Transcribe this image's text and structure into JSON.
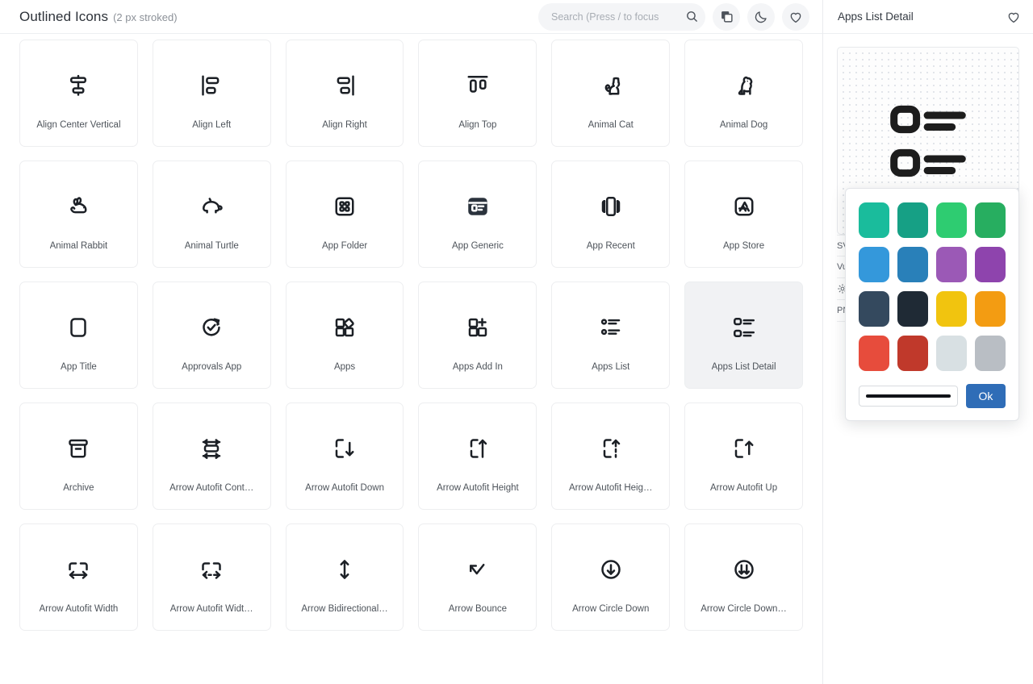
{
  "header": {
    "title_main": "Outlined Icons",
    "title_sub": "(2 px stroked)",
    "search": {
      "placeholder": "Search (Press / to focus",
      "value": ""
    },
    "buttons": [
      {
        "name": "copy-button",
        "icon": "copy-icon"
      },
      {
        "name": "dark-mode-button",
        "icon": "moon-icon"
      },
      {
        "name": "favorites-button",
        "icon": "heart-icon"
      }
    ]
  },
  "grid": {
    "icons": [
      {
        "label": "Align Center Vertical",
        "icon": "align-center-vertical-icon"
      },
      {
        "label": "Align Left",
        "icon": "align-left-icon"
      },
      {
        "label": "Align Right",
        "icon": "align-right-icon"
      },
      {
        "label": "Align Top",
        "icon": "align-top-icon"
      },
      {
        "label": "Animal Cat",
        "icon": "animal-cat-icon"
      },
      {
        "label": "Animal Dog",
        "icon": "animal-dog-icon"
      },
      {
        "label": "Animal Rabbit",
        "icon": "animal-rabbit-icon"
      },
      {
        "label": "Animal Turtle",
        "icon": "animal-turtle-icon"
      },
      {
        "label": "App Folder",
        "icon": "app-folder-icon"
      },
      {
        "label": "App Generic",
        "icon": "app-generic-icon"
      },
      {
        "label": "App Recent",
        "icon": "app-recent-icon"
      },
      {
        "label": "App Store",
        "icon": "app-store-icon"
      },
      {
        "label": "App Title",
        "icon": "app-title-icon"
      },
      {
        "label": "Approvals App",
        "icon": "approvals-app-icon"
      },
      {
        "label": "Apps",
        "icon": "apps-icon"
      },
      {
        "label": "Apps Add In",
        "icon": "apps-add-in-icon"
      },
      {
        "label": "Apps List",
        "icon": "apps-list-icon"
      },
      {
        "label": "Apps List Detail",
        "icon": "apps-list-detail-icon",
        "selected": true
      },
      {
        "label": "Archive",
        "icon": "archive-icon"
      },
      {
        "label": "Arrow Autofit Cont…",
        "icon": "arrow-autofit-content-icon"
      },
      {
        "label": "Arrow Autofit Down",
        "icon": "arrow-autofit-down-icon"
      },
      {
        "label": "Arrow Autofit Height",
        "icon": "arrow-autofit-height-icon"
      },
      {
        "label": "Arrow Autofit Heig…",
        "icon": "arrow-autofit-height-dotted-icon"
      },
      {
        "label": "Arrow Autofit Up",
        "icon": "arrow-autofit-up-icon"
      },
      {
        "label": "Arrow Autofit Width",
        "icon": "arrow-autofit-width-icon"
      },
      {
        "label": "Arrow Autofit Widt…",
        "icon": "arrow-autofit-width-dotted-icon"
      },
      {
        "label": "Arrow Bidirectional…",
        "icon": "arrow-bidirectional-up-down-icon"
      },
      {
        "label": "Arrow Bounce",
        "icon": "arrow-bounce-icon"
      },
      {
        "label": "Arrow Circle Down",
        "icon": "arrow-circle-down-icon"
      },
      {
        "label": "Arrow Circle Down…",
        "icon": "arrow-circle-down-double-icon"
      }
    ]
  },
  "detail": {
    "title": "Apps List Detail",
    "favorite_icon": "heart-icon",
    "preview_icon": "apps-list-detail-icon",
    "color_dot": "#1d1d1d",
    "rows": [
      {
        "label": "SVG",
        "action_icon": "copy-icon"
      },
      {
        "label": "Vue",
        "action_icon": "download-icon"
      },
      {
        "label": "",
        "leading_icon": "gear-icon",
        "action_icon": "chevron-right-icon"
      },
      {
        "label": "PNG",
        "action_icon": "download-icon"
      }
    ]
  },
  "color_popup": {
    "swatches": [
      "#1abc9c",
      "#16a085",
      "#2ecc71",
      "#27ae60",
      "#3498db",
      "#2980b9",
      "#9b59b6",
      "#8e44ad",
      "#34495e",
      "#1f2a35",
      "#f1c40f",
      "#f39c12",
      "#e74c3c",
      "#c0392b",
      "#d8e0e3",
      "#b9bec4"
    ],
    "slider_color": "#111318",
    "ok_label": "Ok",
    "ok_color": "#2f6db7"
  }
}
